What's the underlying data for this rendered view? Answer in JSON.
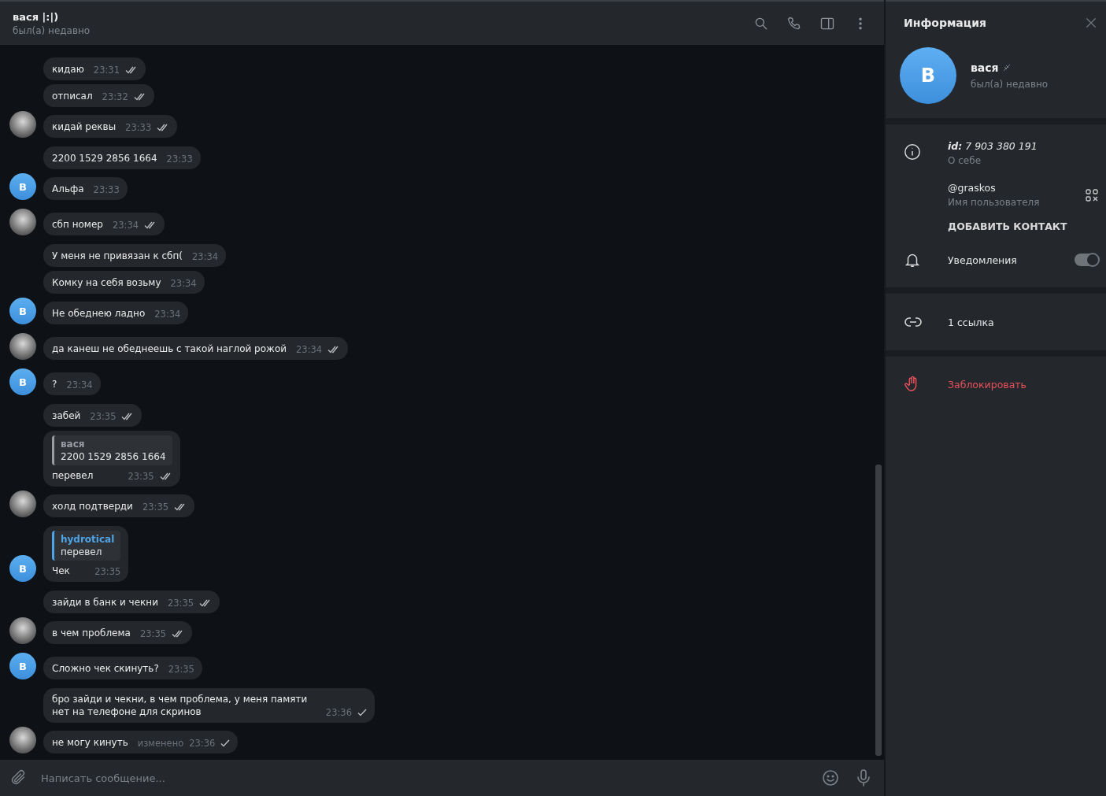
{
  "header": {
    "title": "вася |:|)",
    "status": "был(а) недавно"
  },
  "messages": [
    {
      "text": "кидаю",
      "time": "23:31",
      "read": true
    },
    {
      "text": "отписал",
      "time": "23:32",
      "read": true
    },
    {
      "text": "кидай реквы",
      "time": "23:33",
      "read": true,
      "avatar": {
        "kind": "photo"
      }
    },
    {
      "text": "2200 1529 2856 1664",
      "time": "23:33"
    },
    {
      "text": "Альфа",
      "time": "23:33",
      "avatar": {
        "kind": "letter",
        "letter": "В"
      }
    },
    {
      "text": "сбп номер",
      "time": "23:34",
      "read": true,
      "avatar": {
        "kind": "photo"
      }
    },
    {
      "text": "У меня не привязан к сбп(",
      "time": "23:34"
    },
    {
      "text": "Комку на себя возьму",
      "time": "23:34"
    },
    {
      "text": "Не обеднею ладно",
      "time": "23:34",
      "avatar": {
        "kind": "letter",
        "letter": "В"
      }
    },
    {
      "text": "да канеш не обеднеешь с такой наглой рожой",
      "time": "23:34",
      "read": true,
      "avatar": {
        "kind": "photo"
      }
    },
    {
      "text": "?",
      "time": "23:34",
      "avatar": {
        "kind": "letter",
        "letter": "В"
      }
    },
    {
      "text": "забей",
      "time": "23:35",
      "read": true
    },
    {
      "text": "перевел",
      "time": "23:35",
      "read": true,
      "reply": {
        "name": "вася",
        "text": "2200 1529 2856 1664",
        "color": "#9a9ea3"
      }
    },
    {
      "text": "холд подтверди",
      "time": "23:35",
      "read": true,
      "avatar": {
        "kind": "photo"
      }
    },
    {
      "text": "Чек",
      "time": "23:35",
      "reply": {
        "name": "hydrotical",
        "text": "перевел",
        "color": "#4ea4e6"
      },
      "avatar": {
        "kind": "letter",
        "letter": "В"
      }
    },
    {
      "text": "зайди в банк и чекни",
      "time": "23:35",
      "read": true
    },
    {
      "text": "в чем проблема",
      "time": "23:35",
      "read": true,
      "avatar": {
        "kind": "photo"
      }
    },
    {
      "text": "Сложно чек скинуть?",
      "time": "23:35",
      "avatar": {
        "kind": "letter",
        "letter": "В"
      }
    },
    {
      "text": "бро зайди и чекни, в чем проблема, у меня памяти нет на телефоне для скринов",
      "time": "23:36",
      "read": false
    },
    {
      "text": "не могу кинуть",
      "time": "23:36",
      "edited": "изменено",
      "read": false,
      "avatar": {
        "kind": "photo"
      }
    }
  ],
  "composer": {
    "placeholder": "Написать сообщение..."
  },
  "info_panel": {
    "title": "Информация",
    "avatar_letter": "В",
    "name": "вася",
    "status": "был(а) недавно",
    "id": "**id:** 7 903 380 191",
    "bio_label": "О себе",
    "username": "@graskos",
    "username_label": "Имя пользователя",
    "add_contact": "ДОБАВИТЬ КОНТАКТ",
    "notifications": {
      "label": "Уведомления",
      "on": true
    },
    "links": "1 ссылка",
    "block": "Заблокировать"
  }
}
